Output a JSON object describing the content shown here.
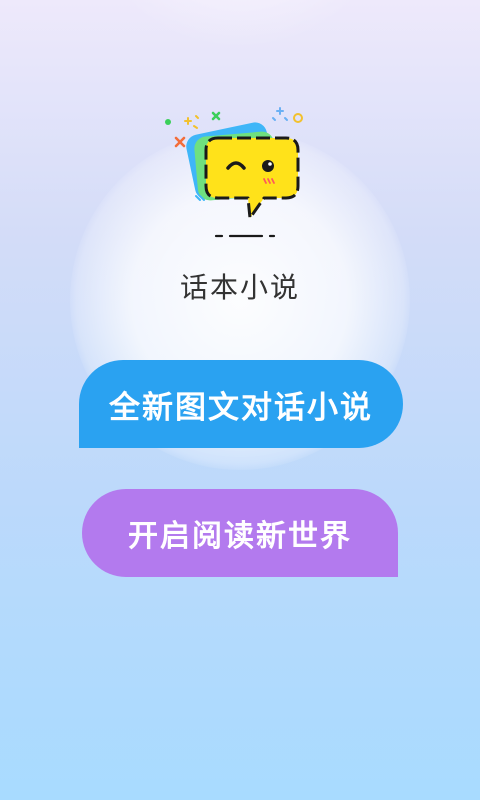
{
  "app": {
    "name": "话本小说"
  },
  "slogan": {
    "line1": "全新图文对话小说",
    "line2": "开启阅读新世界"
  },
  "colors": {
    "blue_bubble": "#2aa2f1",
    "purple_bubble": "#b37aee",
    "logo_yellow": "#ffe21a",
    "logo_green": "#6fe07f",
    "logo_blue": "#3fb6f8"
  },
  "icons": {
    "logo": "chat-bubble-winking-face-icon"
  }
}
